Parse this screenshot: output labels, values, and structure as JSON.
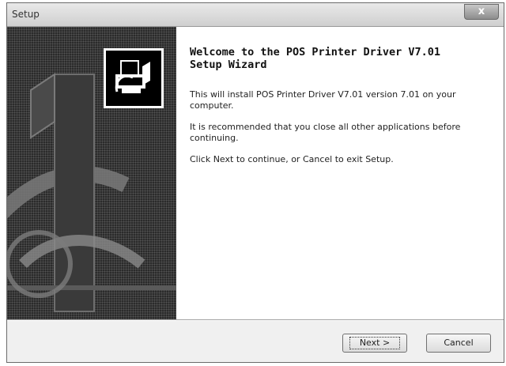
{
  "window": {
    "title": "Setup",
    "close_glyph": "x"
  },
  "wizard": {
    "heading_line1": "Welcome to the POS Printer Driver V7.01",
    "heading_line2": "Setup Wizard",
    "paragraphs": [
      "This will install POS Printer Driver V7.01 version 7.01 on your computer.",
      "It is recommended that you close all other applications before continuing.",
      "Click Next to continue, or Cancel to exit Setup."
    ],
    "icon": "printer-installer-icon"
  },
  "buttons": {
    "next_label": "Next >",
    "cancel_label": "Cancel"
  }
}
